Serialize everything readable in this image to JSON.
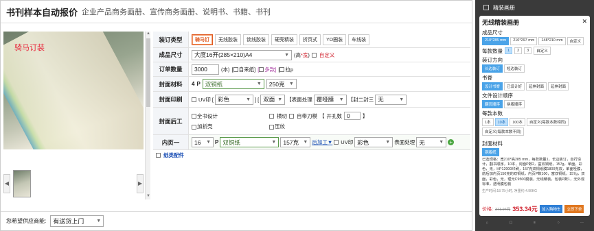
{
  "header": {
    "title": "书刊样本自动报价",
    "subtitle": "企业产品商务画册、宣传商务画册、说明书、书籍、书刊"
  },
  "image": {
    "watermark": "骑马订装"
  },
  "form": {
    "binding": {
      "label": "装订类型",
      "options": [
        "骑马钉",
        "无线胶装",
        "锁线胶装",
        "硬壳精装",
        "折页式",
        "YO圈装",
        "车线装"
      ],
      "selected": 0
    },
    "size": {
      "label": "成品尺寸",
      "value": "大度16开(285×210)A4",
      "hint_prefix": "(高",
      "hint_mid": "*宽",
      "hint_suffix": ")",
      "custom": "自定义"
    },
    "qty": {
      "label": "订单数量",
      "value": "3000",
      "unit": "(本)",
      "self_paper": "自来纸",
      "multi": "多款",
      "pull": "拉p"
    },
    "cover": {
      "label": "封面材料",
      "p": "4",
      "p_label": "P",
      "paper": "双铜纸",
      "weight": "250克"
    },
    "cover_print": {
      "label": "封面印刷",
      "uv": "UV印",
      "color": "彩色",
      "side": "双面",
      "surface_label": "【表面处理",
      "surface": "覆哑膜",
      "cover2_label": "【封二封三",
      "cover2": "无"
    },
    "postpress": {
      "label": "封面后工",
      "items": [
        "全书设计",
        "横切",
        "自带刀模",
        "开孔数",
        "加折壳",
        "压纹"
      ],
      "hole_value": "0"
    },
    "inner": {
      "label": "内页一",
      "p": "16",
      "p_label": "P",
      "paper": "双铜纸",
      "weight": "157克",
      "process": "后加工▼",
      "uv": "UV印",
      "color": "彩色",
      "surface_label": "表面处理",
      "surface": "无"
    },
    "paper_parts": "纸类配件"
  },
  "bottom": {
    "label": "您希望供应商能:",
    "value": "有送货上门"
  },
  "phone": {
    "top_title": "精装画册",
    "title": "无线精装画册",
    "size": {
      "label": "成品尺寸",
      "options": [
        "210*285 mm",
        "210*297 mm",
        "148*210 mm",
        "自定义"
      ]
    },
    "count": {
      "label": "每款数量",
      "options": [
        "1",
        "2",
        "3",
        "自定义"
      ]
    },
    "direction": {
      "label": "装订方向",
      "options": [
        "长边装订",
        "短边装订"
      ]
    },
    "spine": {
      "label": "书脊",
      "options": [
        "设计书脊",
        "已设计好",
        "延伸封面",
        "延伸封面"
      ]
    },
    "file_order": {
      "label": "文件设计顺序",
      "options": [
        "翻页顺序",
        "拼版顺序"
      ]
    },
    "copies": {
      "label": "每款本数",
      "options": [
        "1本",
        "10本",
        "100本",
        "自定义(每款本数相同)",
        "自定义(每款本数不同)"
      ]
    },
    "cover_material": {
      "label": "封面材料",
      "options": [
        "铜版纸"
      ]
    },
    "description": "已选规格：宽210*高285 mm，每款数量1，长边装订，自行设计，翻书顺序，10本，封面P数2，富双铜纸，157g，单面，彩色，无，HP12000印刷，157克双铜纸膜1800克双，单面哑膜，前后加内页150克的双铜纸，内页P数100，富双铜纸，157g，双面，彩色，无，理光C9500膜装，无线精装，包装P数1，无外观标准，透明膜包装",
    "meta": "生产时间:18.75小时, 净重约:4.90KG",
    "price_label": "价格:",
    "old_price": "371.94元",
    "price": "353.34元",
    "cart": "加入购物车",
    "buy": "立即下单"
  },
  "colors": {
    "accent": "#e05a20",
    "link": "#1b4fb5",
    "price": "#d0202c",
    "phone_blue": "#4aa3e8"
  }
}
